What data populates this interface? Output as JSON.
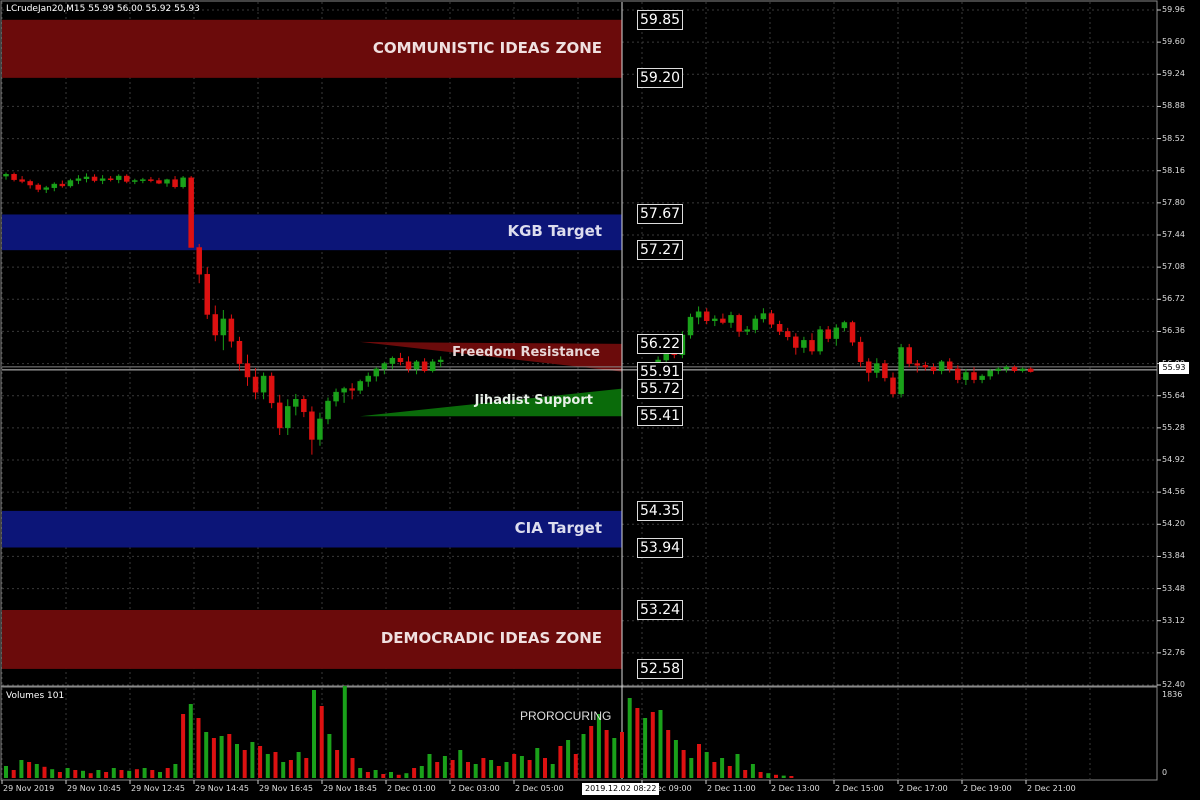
{
  "header": {
    "title": "LCrudeJan20,M15  55.99 56.00 55.92 55.93",
    "volumes_label": "Volumes 101"
  },
  "current_price": "55.93",
  "crosshair_date": "2019.12.02 08:22",
  "proc_label": "PROROCURING",
  "colors": {
    "bull": "#1aa11a",
    "bear": "#dd1111",
    "zone_red": "#6b0b0b",
    "zone_blue": "#0c1578",
    "support_green": "#0a6b0a",
    "grid": "#3a3a3a"
  },
  "zones": [
    {
      "name": "communistic",
      "label": "COMMUNISTIC IDEAS ZONE",
      "from": 59.2,
      "to": 59.85,
      "color": "red",
      "text_color": "#f0e0e0",
      "top_box": "59.85",
      "bottom_box": "59.20"
    },
    {
      "name": "kgb",
      "label": "KGB Target",
      "from": 57.27,
      "to": 57.67,
      "color": "blue",
      "text_color": "#dde",
      "top_box": "57.67",
      "bottom_box": "57.27"
    },
    {
      "name": "cia",
      "label": "CIA Target",
      "from": 53.94,
      "to": 54.35,
      "color": "blue",
      "text_color": "#dde",
      "top_box": "54.35",
      "bottom_box": "53.94"
    },
    {
      "name": "democradic",
      "label": "DEMOCRADIC IDEAS ZONE",
      "from": 52.58,
      "to": 53.24,
      "color": "red",
      "text_color": "#f0e0e0",
      "top_box": "53.24",
      "bottom_box": "52.58"
    }
  ],
  "wedges": [
    {
      "name": "freedom-resistance",
      "label": "Freedom Resistance",
      "top_box": "56.22",
      "bottom_box": "55.91"
    },
    {
      "name": "jihadist-support",
      "label": "Jihadist Support",
      "top_box": "55.72",
      "bottom_box": "55.41"
    }
  ],
  "chart_data": {
    "type": "candlestick",
    "y_ticks": [
      "59.96",
      "59.60",
      "59.24",
      "58.88",
      "58.52",
      "58.16",
      "57.80",
      "57.44",
      "57.08",
      "56.72",
      "56.36",
      "56.00",
      "55.64",
      "55.28",
      "54.92",
      "54.56",
      "54.20",
      "53.84",
      "53.48",
      "53.12",
      "52.76",
      "52.40"
    ],
    "x_ticks": [
      "29 Nov 2019",
      "29 Nov 10:45",
      "29 Nov 12:45",
      "29 Nov 14:45",
      "29 Nov 16:45",
      "29 Nov 18:45",
      "2 Dec 01:00",
      "2 Dec 03:00",
      "2 Dec 05:00",
      "2 Dec 09:00",
      "2 Dec 11:00",
      "2 Dec 13:00",
      "2 Dec 15:00",
      "2 Dec 17:00",
      "2 Dec 19:00",
      "2 Dec 21:00"
    ],
    "ylim": [
      52.4,
      59.96
    ],
    "volume_ticks": [
      "1836",
      "0"
    ],
    "candles": [
      [
        58.1,
        58.14,
        58.06,
        58.12
      ],
      [
        58.12,
        58.14,
        58.04,
        58.06
      ],
      [
        58.06,
        58.1,
        58.02,
        58.04
      ],
      [
        58.04,
        58.06,
        57.96,
        58.0
      ],
      [
        58.0,
        58.02,
        57.92,
        57.95
      ],
      [
        57.95,
        57.99,
        57.91,
        57.97
      ],
      [
        57.97,
        58.03,
        57.93,
        58.01
      ],
      [
        58.01,
        58.05,
        57.97,
        57.99
      ],
      [
        57.99,
        58.07,
        57.97,
        58.05
      ],
      [
        58.05,
        58.11,
        58.01,
        58.07
      ],
      [
        58.07,
        58.13,
        58.03,
        58.09
      ],
      [
        58.09,
        58.12,
        58.03,
        58.05
      ],
      [
        58.05,
        58.11,
        58.01,
        58.07
      ],
      [
        58.07,
        58.1,
        58.04,
        58.06
      ],
      [
        58.06,
        58.12,
        58.02,
        58.1
      ],
      [
        58.1,
        58.12,
        58.02,
        58.04
      ],
      [
        58.04,
        58.07,
        58.01,
        58.05
      ],
      [
        58.05,
        58.08,
        58.02,
        58.06
      ],
      [
        58.06,
        58.09,
        58.03,
        58.05
      ],
      [
        58.05,
        58.08,
        58.01,
        58.02
      ],
      [
        58.02,
        58.07,
        57.98,
        58.06
      ],
      [
        58.06,
        58.1,
        57.96,
        57.98
      ],
      [
        57.98,
        58.1,
        57.96,
        58.08
      ],
      [
        58.08,
        58.1,
        57.3,
        57.3
      ],
      [
        57.3,
        57.34,
        56.9,
        57.0
      ],
      [
        57.0,
        57.08,
        56.5,
        56.55
      ],
      [
        56.55,
        56.65,
        56.25,
        56.32
      ],
      [
        56.32,
        56.6,
        56.15,
        56.5
      ],
      [
        56.5,
        56.55,
        56.18,
        56.25
      ],
      [
        56.25,
        56.3,
        55.92,
        56.0
      ],
      [
        56.0,
        56.1,
        55.75,
        55.85
      ],
      [
        55.85,
        55.95,
        55.6,
        55.68
      ],
      [
        55.68,
        55.9,
        55.6,
        55.86
      ],
      [
        55.86,
        55.9,
        55.5,
        55.56
      ],
      [
        55.56,
        55.65,
        55.2,
        55.28
      ],
      [
        55.28,
        55.6,
        55.2,
        55.52
      ],
      [
        55.52,
        55.66,
        55.42,
        55.6
      ],
      [
        55.6,
        55.64,
        55.4,
        55.46
      ],
      [
        55.46,
        55.52,
        54.98,
        55.15
      ],
      [
        55.15,
        55.45,
        55.08,
        55.38
      ],
      [
        55.38,
        55.62,
        55.32,
        55.58
      ],
      [
        55.58,
        55.72,
        55.52,
        55.68
      ],
      [
        55.68,
        55.74,
        55.56,
        55.72
      ],
      [
        55.72,
        55.78,
        55.6,
        55.7
      ],
      [
        55.7,
        55.82,
        55.66,
        55.8
      ],
      [
        55.8,
        55.9,
        55.74,
        55.86
      ],
      [
        55.86,
        55.96,
        55.8,
        55.94
      ],
      [
        55.94,
        56.02,
        55.88,
        56.0
      ],
      [
        56.0,
        56.08,
        55.94,
        56.06
      ],
      [
        56.06,
        56.12,
        55.98,
        56.02
      ],
      [
        56.02,
        56.08,
        55.9,
        55.94
      ],
      [
        55.94,
        56.04,
        55.88,
        56.02
      ],
      [
        56.02,
        56.06,
        55.9,
        55.92
      ],
      [
        55.92,
        56.05,
        55.9,
        56.02
      ],
      [
        56.02,
        56.08,
        55.96,
        56.04
      ]
    ],
    "candles2": [
      [
        55.92,
        55.98,
        55.86,
        55.94
      ],
      [
        55.94,
        56.08,
        55.9,
        56.04
      ],
      [
        56.04,
        56.22,
        56.0,
        56.18
      ],
      [
        56.18,
        56.24,
        56.06,
        56.1
      ],
      [
        56.1,
        56.36,
        56.06,
        56.32
      ],
      [
        56.32,
        56.56,
        56.28,
        56.52
      ],
      [
        56.52,
        56.64,
        56.44,
        56.58
      ],
      [
        56.58,
        56.62,
        56.44,
        56.48
      ],
      [
        56.48,
        56.54,
        56.42,
        56.5
      ],
      [
        56.5,
        56.56,
        56.44,
        56.46
      ],
      [
        56.46,
        56.58,
        56.4,
        56.54
      ],
      [
        56.54,
        56.56,
        56.3,
        56.36
      ],
      [
        56.36,
        56.42,
        56.32,
        56.38
      ],
      [
        56.38,
        56.54,
        56.34,
        56.5
      ],
      [
        56.5,
        56.62,
        56.46,
        56.56
      ],
      [
        56.56,
        56.6,
        56.4,
        56.44
      ],
      [
        56.44,
        56.48,
        56.32,
        56.36
      ],
      [
        56.36,
        56.4,
        56.26,
        56.3
      ],
      [
        56.3,
        56.34,
        56.1,
        56.18
      ],
      [
        56.18,
        56.3,
        56.12,
        56.26
      ],
      [
        56.26,
        56.34,
        56.1,
        56.14
      ],
      [
        56.14,
        56.42,
        56.1,
        56.38
      ],
      [
        56.38,
        56.42,
        56.24,
        56.28
      ],
      [
        56.28,
        56.44,
        56.2,
        56.4
      ],
      [
        56.4,
        56.48,
        56.36,
        56.46
      ],
      [
        56.46,
        56.48,
        56.2,
        56.24
      ],
      [
        56.24,
        56.3,
        55.96,
        56.02
      ],
      [
        56.02,
        56.06,
        55.8,
        55.9
      ],
      [
        55.9,
        56.06,
        55.84,
        56.0
      ],
      [
        56.0,
        56.04,
        55.8,
        55.84
      ],
      [
        55.84,
        55.9,
        55.62,
        55.66
      ],
      [
        55.66,
        56.22,
        55.62,
        56.18
      ],
      [
        56.18,
        56.22,
        55.96,
        56.0
      ],
      [
        56.0,
        56.04,
        55.9,
        55.98
      ],
      [
        55.98,
        56.02,
        55.92,
        55.96
      ],
      [
        55.96,
        56.0,
        55.88,
        55.92
      ],
      [
        55.92,
        56.04,
        55.88,
        56.02
      ],
      [
        56.02,
        56.06,
        55.9,
        55.94
      ],
      [
        55.94,
        55.98,
        55.78,
        55.82
      ],
      [
        55.82,
        55.94,
        55.76,
        55.9
      ],
      [
        55.9,
        55.96,
        55.78,
        55.82
      ],
      [
        55.82,
        55.88,
        55.78,
        55.86
      ],
      [
        55.86,
        55.94,
        55.82,
        55.92
      ],
      [
        55.92,
        55.96,
        55.88,
        55.94
      ],
      [
        55.94,
        55.98,
        55.9,
        55.96
      ],
      [
        55.96,
        55.98,
        55.9,
        55.92
      ],
      [
        55.92,
        55.96,
        55.9,
        55.94
      ],
      [
        55.94,
        55.96,
        55.9,
        55.91
      ]
    ],
    "volumes": [
      [
        30,
        1
      ],
      [
        20,
        0
      ],
      [
        45,
        1
      ],
      [
        40,
        0
      ],
      [
        35,
        1
      ],
      [
        28,
        0
      ],
      [
        22,
        1
      ],
      [
        15,
        0
      ],
      [
        25,
        1
      ],
      [
        20,
        0
      ],
      [
        18,
        1
      ],
      [
        12,
        0
      ],
      [
        20,
        1
      ],
      [
        15,
        0
      ],
      [
        25,
        1
      ],
      [
        20,
        0
      ],
      [
        18,
        1
      ],
      [
        22,
        0
      ],
      [
        25,
        1
      ],
      [
        20,
        0
      ],
      [
        15,
        1
      ],
      [
        25,
        0
      ],
      [
        35,
        1
      ],
      [
        160,
        0
      ],
      [
        185,
        1
      ],
      [
        150,
        0
      ],
      [
        115,
        1
      ],
      [
        100,
        0
      ],
      [
        105,
        1
      ],
      [
        110,
        0
      ],
      [
        85,
        1
      ],
      [
        70,
        0
      ],
      [
        90,
        1
      ],
      [
        80,
        0
      ],
      [
        60,
        1
      ],
      [
        65,
        0
      ],
      [
        40,
        1
      ],
      [
        45,
        0
      ],
      [
        65,
        1
      ],
      [
        50,
        0
      ],
      [
        220,
        1
      ],
      [
        180,
        0
      ],
      [
        110,
        1
      ],
      [
        70,
        0
      ],
      [
        230,
        1
      ],
      [
        50,
        0
      ],
      [
        25,
        1
      ],
      [
        15,
        0
      ],
      [
        20,
        1
      ],
      [
        10,
        0
      ],
      [
        15,
        1
      ],
      [
        8,
        0
      ],
      [
        12,
        1
      ],
      [
        25,
        0
      ],
      [
        30,
        1
      ],
      [
        60,
        1
      ],
      [
        40,
        0
      ],
      [
        55,
        1
      ],
      [
        45,
        0
      ],
      [
        70,
        1
      ],
      [
        40,
        0
      ],
      [
        35,
        1
      ],
      [
        50,
        0
      ],
      [
        45,
        1
      ],
      [
        30,
        0
      ],
      [
        40,
        1
      ],
      [
        60,
        0
      ],
      [
        55,
        1
      ],
      [
        45,
        0
      ],
      [
        75,
        1
      ],
      [
        50,
        0
      ],
      [
        35,
        1
      ],
      [
        80,
        0
      ],
      [
        95,
        1
      ],
      [
        60,
        0
      ],
      [
        110,
        1
      ],
      [
        130,
        0
      ],
      [
        160,
        1
      ],
      [
        120,
        0
      ],
      [
        100,
        1
      ],
      [
        115,
        0
      ],
      [
        200,
        1
      ],
      [
        175,
        0
      ],
      [
        150,
        1
      ],
      [
        165,
        0
      ],
      [
        170,
        1
      ],
      [
        120,
        0
      ],
      [
        95,
        1
      ],
      [
        70,
        0
      ],
      [
        50,
        1
      ],
      [
        85,
        0
      ],
      [
        65,
        1
      ],
      [
        40,
        0
      ],
      [
        50,
        1
      ],
      [
        30,
        0
      ],
      [
        60,
        1
      ],
      [
        20,
        0
      ],
      [
        35,
        1
      ],
      [
        15,
        0
      ],
      [
        12,
        1
      ],
      [
        8,
        0
      ],
      [
        6,
        1
      ],
      [
        5,
        0
      ]
    ]
  }
}
